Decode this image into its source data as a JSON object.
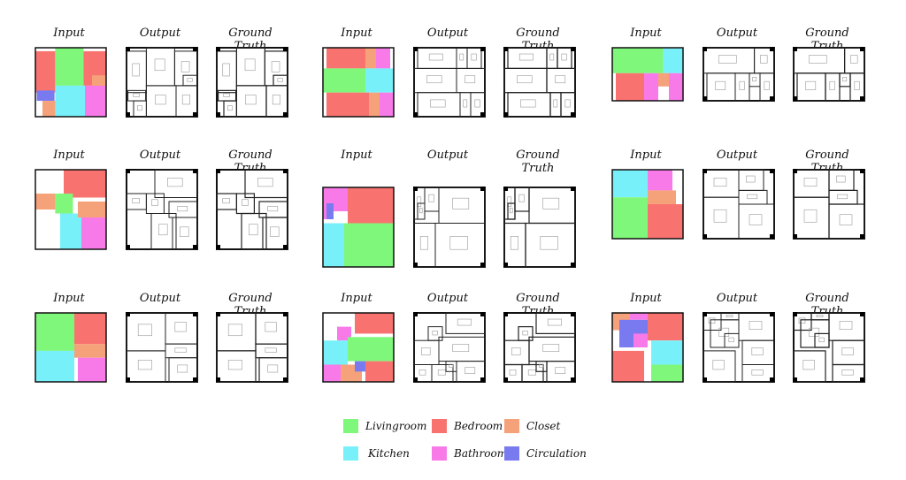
{
  "figure": {
    "column_labels": {
      "input": "Input",
      "output": "Output",
      "ground_truth": "Ground Truth"
    },
    "examples": [
      {
        "id": 1
      },
      {
        "id": 2
      },
      {
        "id": 3
      },
      {
        "id": 4
      },
      {
        "id": 5
      },
      {
        "id": 6
      },
      {
        "id": 7
      },
      {
        "id": 8
      },
      {
        "id": 9
      }
    ]
  },
  "legend": {
    "items": [
      {
        "label": "Livingroom",
        "color": "#7ff77a"
      },
      {
        "label": "Bedroom",
        "color": "#f8736f"
      },
      {
        "label": "Closet",
        "color": "#f5a17a"
      },
      {
        "label": "Kitchen",
        "color": "#78f0fa"
      },
      {
        "label": "Bathroom",
        "color": "#f77ae8"
      },
      {
        "label": "Circulation",
        "color": "#7a7af0"
      }
    ]
  }
}
